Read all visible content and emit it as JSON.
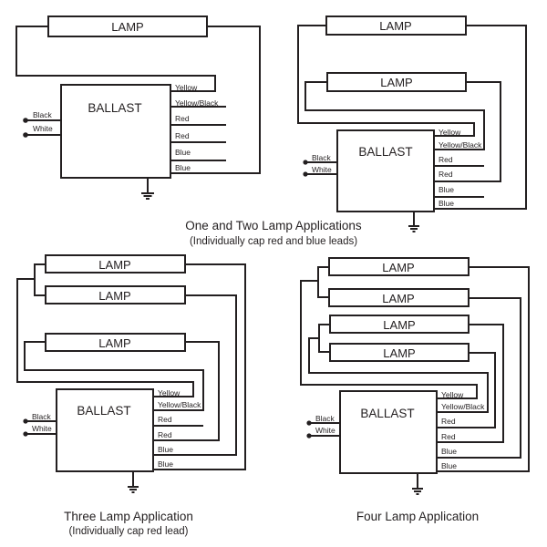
{
  "colors": {
    "line": "#231f20",
    "background": "#ffffff"
  },
  "labels": {
    "lamp": "LAMP",
    "ballast": "BALLAST",
    "input_leads": [
      "Black",
      "White"
    ],
    "output_leads": [
      "Yellow",
      "Yellow/Black",
      "Red",
      "Red",
      "Blue",
      "Blue"
    ]
  },
  "captions": {
    "one_two": {
      "title": "One and Two Lamp Applications",
      "note": "(Individually cap red and blue leads)"
    },
    "three": {
      "title": "Three Lamp Application",
      "note": "(Individually cap red lead)"
    },
    "four": {
      "title": "Four Lamp Application"
    }
  },
  "diagrams": [
    {
      "id": "one-lamp",
      "lamp_count": 1,
      "capped_leads": [
        "Yellow/Black",
        "Red",
        "Red",
        "Blue"
      ]
    },
    {
      "id": "two-lamp",
      "lamp_count": 2,
      "capped_leads": [
        "Red",
        "Blue"
      ]
    },
    {
      "id": "three-lamp",
      "lamp_count": 3,
      "capped_leads": [
        "Red"
      ]
    },
    {
      "id": "four-lamp",
      "lamp_count": 4,
      "capped_leads": []
    }
  ]
}
